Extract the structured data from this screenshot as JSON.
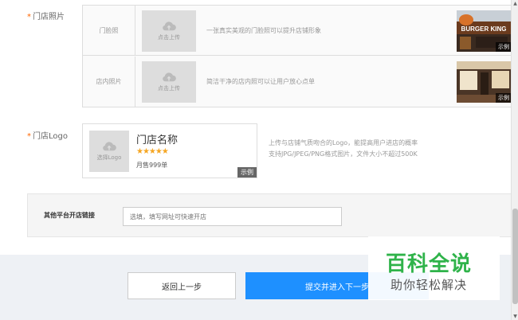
{
  "store_photos": {
    "label": "门店照片",
    "rows": [
      {
        "name": "门脸照",
        "upload": "点击上传",
        "desc": "一张真实美观的门脸照可以提升店铺形象",
        "example": "示例",
        "example_img_text": "BURGER KING"
      },
      {
        "name": "店内照片",
        "upload": "点击上传",
        "desc": "简洁干净的店内照可以让用户放心点单",
        "example": "示例"
      }
    ]
  },
  "store_logo": {
    "label": "门店Logo",
    "upload": "选择Logo",
    "preview": {
      "name": "门店名称",
      "stars": "★★★★★",
      "monthly": "月售999单",
      "example": "示例"
    },
    "desc_line1": "上传与店铺气质吻合的Logo，能提高用户进店的概率",
    "desc_line2": "支持JPG/JPEG/PNG格式图片，文件大小不超过500K"
  },
  "other_platform": {
    "label": "其他平台开店链接",
    "placeholder": "选填，填写网址可快速开店"
  },
  "footer": {
    "back": "返回上一步",
    "submit": "提交并进入下一步"
  },
  "watermark": {
    "title": "百科全说",
    "subtitle": "助你轻松解决"
  },
  "colors": {
    "accent": "#1e90ff",
    "required": "#ff6600",
    "star": "#f5a623",
    "watermark_green": "#2fb34a"
  }
}
